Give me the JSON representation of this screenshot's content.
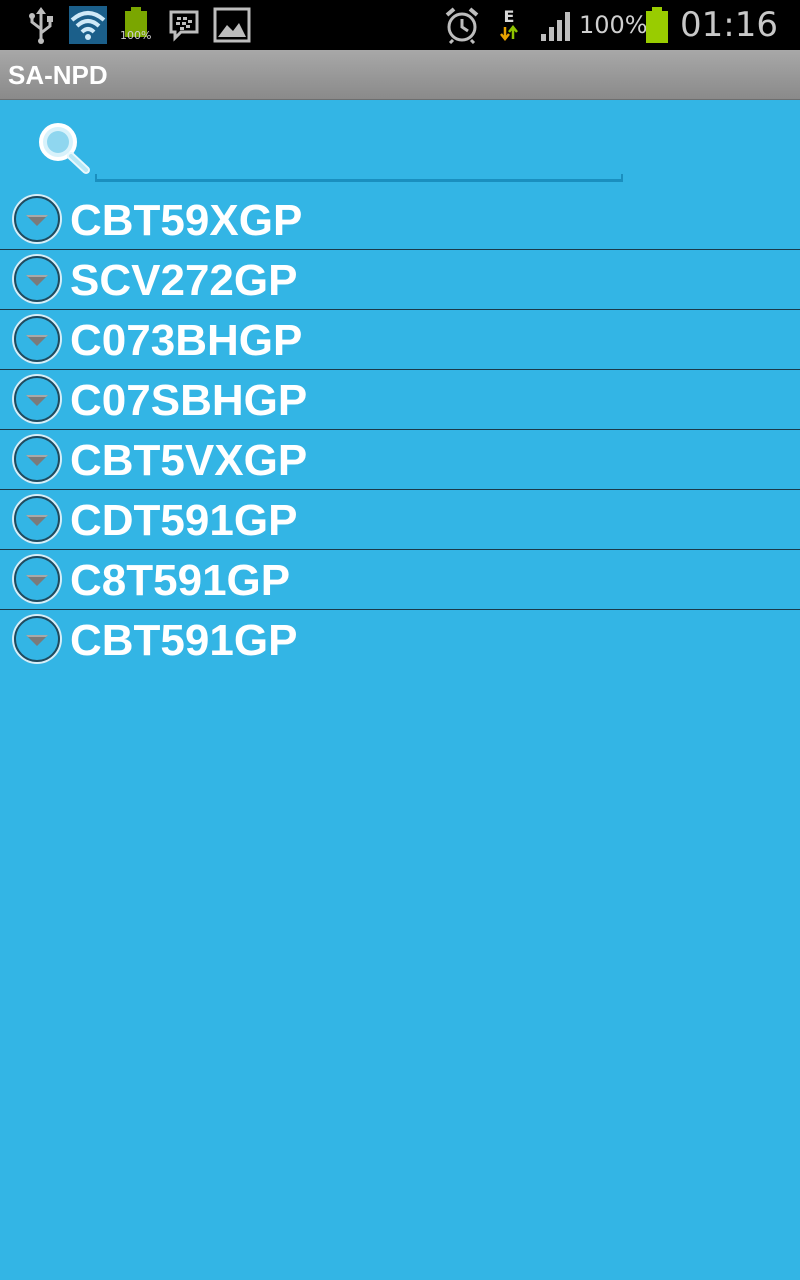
{
  "status_bar": {
    "battery_percent_text": "100%",
    "mini_battery_text": "100%",
    "network_type": "E",
    "time": "01:16",
    "icons": [
      "usb-icon",
      "wifi-icon",
      "battery-small-icon",
      "bbm-icon",
      "gallery-icon",
      "alarm-icon",
      "data-edge-icon",
      "signal-icon",
      "battery-icon"
    ]
  },
  "app": {
    "title": "SA-NPD"
  },
  "search": {
    "value": "",
    "placeholder": ""
  },
  "list": {
    "items": [
      {
        "label": "CBT59XGP"
      },
      {
        "label": "SCV272GP"
      },
      {
        "label": "C073BHGP"
      },
      {
        "label": "C07SBHGP"
      },
      {
        "label": "CBT5VXGP"
      },
      {
        "label": "CDT591GP"
      },
      {
        "label": "C8T591GP"
      },
      {
        "label": "CBT591GP"
      }
    ]
  },
  "colors": {
    "background": "#33b5e5",
    "title_bar": "#9a9a9a",
    "status_bar": "#000000",
    "battery_green": "#99cc00",
    "divider": "#1a3a4a"
  }
}
